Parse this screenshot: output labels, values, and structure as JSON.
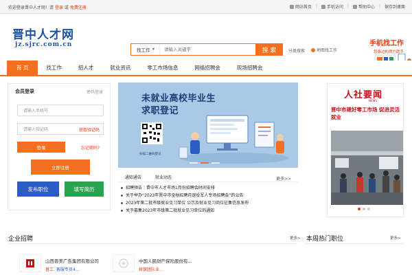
{
  "topbar": {
    "welcome": "欢迎登录晋中人才网！请",
    "login": "登录",
    "or": "或",
    "register": "免费注册",
    "links": [
      "网站首页",
      "手机访问",
      "帮助中心",
      "保存到桌面"
    ]
  },
  "header": {
    "logo_cn": "晋中人才网",
    "logo_en": "jz.sjrc.com.cn",
    "search_type": "找工作",
    "search_placeholder": "请输入关键字",
    "search_button": "搜 索",
    "category_search": "分类搜索",
    "map_job": "地图找工作",
    "mobile_title": "手机找工作",
    "mobile_sub": "您身边的得力助手"
  },
  "nav": [
    "首 页",
    "找工作",
    "招人才",
    "就业资讯",
    "零工市场信息",
    "网络招聘会",
    "现场招聘会"
  ],
  "login": {
    "title": "会员登录",
    "alt": "密码登录",
    "phone_placeholder": "请输入手机号",
    "code_placeholder": "请输入验证码",
    "get_code": "获取验证码",
    "login_button": "登录",
    "forgot": "忘记密码?",
    "register_button": "立即注册",
    "publish_button": "发布职位",
    "resume_button": "填写简历"
  },
  "banner": {
    "line1": "未就业高校毕业生",
    "line2": "求职登记",
    "qr_label": "扫描二维码登记"
  },
  "news": {
    "tabs": [
      "通知通告",
      "就业动态"
    ],
    "more": "更多>>",
    "items": [
      "招聘预告｜晋中市人才市场1月份招聘会时间安排",
      "关于举办“2023年晋中市金秋招聘月退役军人专场招聘会”的公告",
      "2023年第二批市级就业见习单位 公示及就业见习岗位征集信息发布",
      "关于募集2023年市级第二批就业见习单位的通知"
    ]
  },
  "side": {
    "logo": "人社要闻",
    "logo_sub": "NEWS",
    "headline": "晋中市建好零工市场 促进灵活就业"
  },
  "sections": {
    "company": "企业招聘",
    "company_more": "更多>",
    "hot": "本周热门职位",
    "hot_more": "更多>"
  },
  "companies": [
    {
      "name": "山西晋美广告集团有限公司",
      "job1": "普工",
      "job2": "客服专员4..."
    },
    {
      "name": "中国人民财产保险股份有...",
      "job1": "续保团队业..."
    }
  ],
  "colors": {
    "accent": "#f37021",
    "brand_blue": "#1a4fa3",
    "red": "#e8380d",
    "blue_btn": "#2a5cc4",
    "green_btn": "#2aa350"
  }
}
